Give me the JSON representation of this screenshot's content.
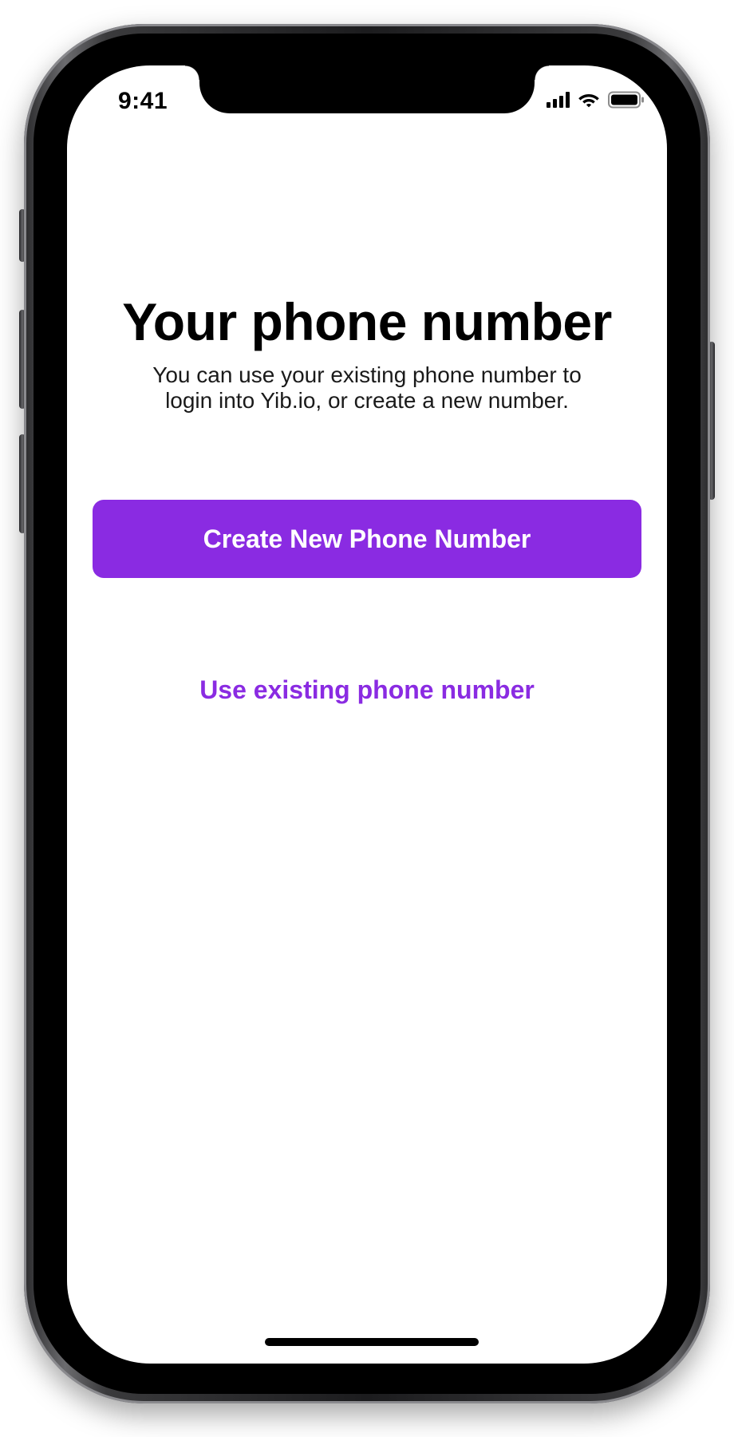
{
  "status_bar": {
    "time": "9:41",
    "icons": [
      "cellular-signal-icon",
      "wifi-icon",
      "battery-icon"
    ]
  },
  "onboarding": {
    "title": "Your phone number",
    "subtitle_line1": "You can use your existing phone number to",
    "subtitle_line2": "login into Yib.io, or create a new number.",
    "primary_button_label": "Create New Phone Number",
    "secondary_link_label": "Use existing phone number"
  },
  "colors": {
    "accent": "#8a2be2",
    "background": "#ffffff",
    "text": "#000000"
  }
}
